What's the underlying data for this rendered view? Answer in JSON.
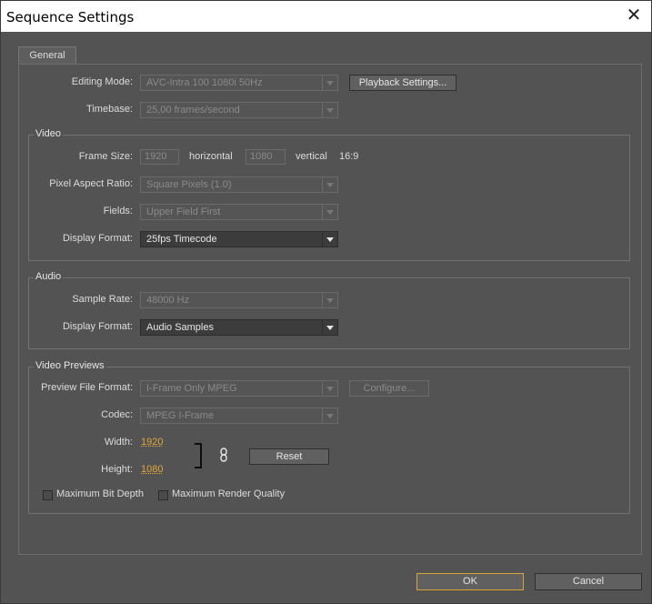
{
  "window": {
    "title": "Sequence Settings",
    "close_glyph": "✕"
  },
  "tabs": [
    {
      "label": "General"
    }
  ],
  "general": {
    "editing_mode": {
      "label": "Editing Mode:",
      "value": "AVC-Intra 100 1080i 50Hz"
    },
    "playback_settings_label": "Playback Settings...",
    "timebase": {
      "label": "Timebase:",
      "value": "25,00 frames/second"
    }
  },
  "video": {
    "title": "Video",
    "frame_size": {
      "label": "Frame Size:",
      "horizontal": "1920",
      "horizontal_label": "horizontal",
      "vertical": "1080",
      "vertical_label": "vertical",
      "aspect": "16:9"
    },
    "pixel_aspect": {
      "label": "Pixel Aspect Ratio:",
      "value": "Square Pixels (1.0)"
    },
    "fields": {
      "label": "Fields:",
      "value": "Upper Field First"
    },
    "display_format": {
      "label": "Display Format:",
      "value": "25fps Timecode"
    }
  },
  "audio": {
    "title": "Audio",
    "sample_rate": {
      "label": "Sample Rate:",
      "value": "48000 Hz"
    },
    "display_format": {
      "label": "Display Format:",
      "value": "Audio Samples"
    }
  },
  "video_previews": {
    "title": "Video Previews",
    "preview_file_format": {
      "label": "Preview File Format:",
      "value": "I-Frame Only MPEG"
    },
    "configure_label": "Configure...",
    "codec": {
      "label": "Codec:",
      "value": "MPEG I-Frame"
    },
    "width": {
      "label": "Width:",
      "value": "1920"
    },
    "height": {
      "label": "Height:",
      "value": "1080"
    },
    "reset_label": "Reset",
    "max_bit_depth_label": "Maximum Bit Depth",
    "max_render_quality_label": "Maximum Render Quality"
  },
  "footer": {
    "ok_label": "OK",
    "cancel_label": "Cancel"
  },
  "colors": {
    "accent": "#e0a63c",
    "panel": "#535353",
    "ok_border": "#d8a33a"
  }
}
